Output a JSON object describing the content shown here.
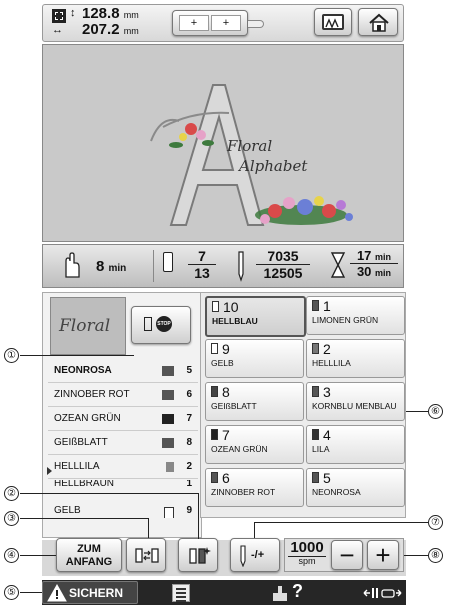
{
  "top_bar": {
    "height_value": "128.8",
    "width_value": "207.2",
    "unit": "mm",
    "home_icon": "home-icon",
    "display_icon": "screen-icon"
  },
  "preview": {
    "title_line1": "Floral",
    "title_line2": "Alphabet"
  },
  "stats": {
    "time_value": "8",
    "time_unit": "min",
    "color_num": "7",
    "color_den": "13",
    "stitch_num": "7035",
    "stitch_den": "12505",
    "time_num": "17",
    "time_den": "30",
    "time_unit2": "min"
  },
  "left": {
    "pattern_name": "Floral",
    "list": [
      {
        "label": "NEONROSA",
        "num": "5"
      },
      {
        "label": "ZINNOBER ROT",
        "num": "6"
      },
      {
        "label": "OZEAN GRÜN",
        "num": "7"
      },
      {
        "label": "GEIßBLATT",
        "num": "8"
      },
      {
        "label": "HELLLILA",
        "num": "2"
      },
      {
        "label": "HELLBRAUN",
        "num": "1"
      },
      {
        "label": "GELB",
        "num": "9"
      }
    ]
  },
  "grid": {
    "cells": [
      {
        "num": "10",
        "name": "HELLBLAU"
      },
      {
        "num": "1",
        "name": "LIMONEN GRÜN"
      },
      {
        "num": "9",
        "name": "GELB"
      },
      {
        "num": "2",
        "name": "HELLLILA"
      },
      {
        "num": "8",
        "name": "GEIßBLATT"
      },
      {
        "num": "3",
        "name": "KORNBLU MENBLAU"
      },
      {
        "num": "7",
        "name": "OZEAN GRÜN"
      },
      {
        "num": "4",
        "name": "LILA"
      },
      {
        "num": "6",
        "name": "ZINNOBER ROT"
      },
      {
        "num": "5",
        "name": "NEONROSA"
      }
    ]
  },
  "controls": {
    "zum_line1": "ZUM",
    "zum_line2": "ANFANG",
    "speed": "1000",
    "speed_unit": "spm",
    "minus": "−",
    "plus": "+",
    "stitch_adjust": "-/+"
  },
  "bottom_bar": {
    "save_label": "SICHERN",
    "help_mark": "?"
  },
  "callouts": [
    "①",
    "②",
    "③",
    "④",
    "⑤",
    "⑥",
    "⑦",
    "⑧"
  ],
  "colors": {
    "dark_bar": "#262626",
    "selected_border": "#555555",
    "preview_bg": "#c9c9c9"
  }
}
